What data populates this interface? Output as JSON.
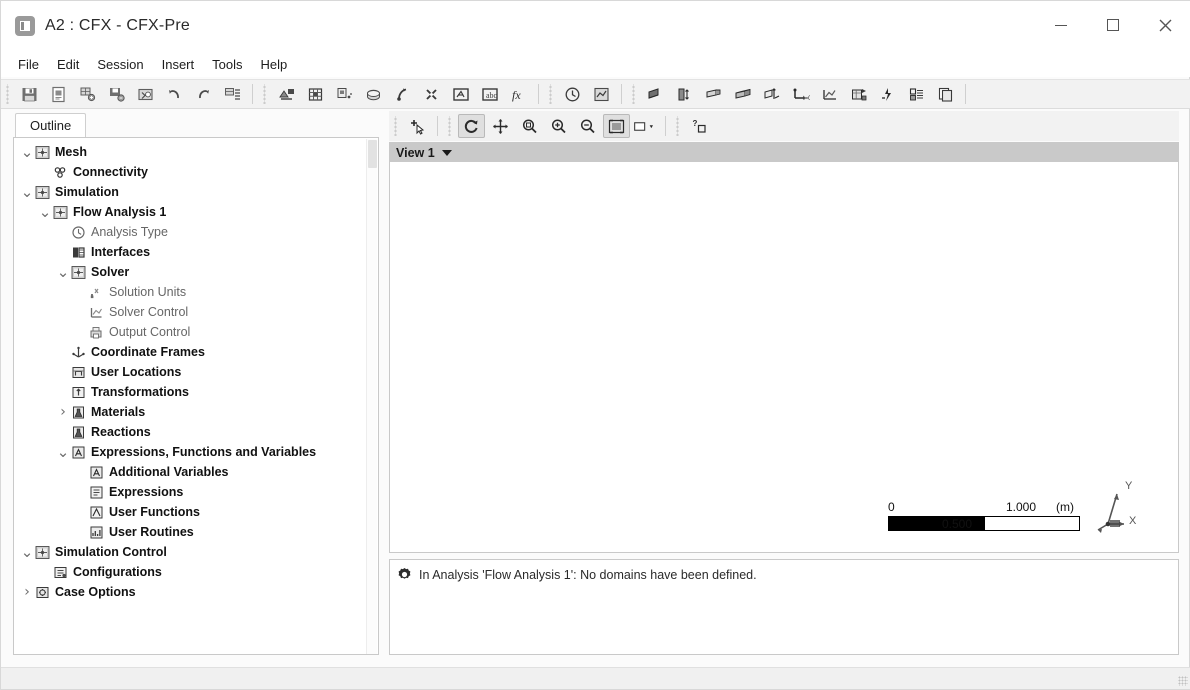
{
  "window": {
    "title": "A2 : CFX - CFX-Pre",
    "app_icon": "cfx-app-icon",
    "controls": {
      "minimize": "minimize-button",
      "maximize": "maximize-button",
      "close": "close-button"
    }
  },
  "menubar": {
    "items": [
      {
        "label": "File"
      },
      {
        "label": "Edit"
      },
      {
        "label": "Session"
      },
      {
        "label": "Insert"
      },
      {
        "label": "Tools"
      },
      {
        "label": "Help"
      }
    ]
  },
  "toolbar": {
    "groups": [
      {
        "buttons": [
          {
            "icon": "save-icon",
            "title": "Save Case"
          },
          {
            "icon": "save-as-icon",
            "title": "Save Case As"
          },
          {
            "icon": "import-mesh-icon",
            "title": "Import Mesh"
          },
          {
            "icon": "export-mesh-icon",
            "title": "Export Mesh"
          },
          {
            "icon": "refresh-mesh-icon",
            "title": "Reload Mesh Files"
          },
          {
            "icon": "undo-icon",
            "title": "Undo"
          },
          {
            "icon": "redo-icon",
            "title": "Redo"
          },
          {
            "icon": "define-run-icon",
            "title": "Define Run"
          }
        ]
      },
      {
        "buttons": [
          {
            "icon": "domain-icon",
            "title": "Insert Domain"
          },
          {
            "icon": "boundary-icon",
            "title": "Insert Boundary"
          },
          {
            "icon": "subdomain-icon",
            "title": "Insert Subdomain"
          },
          {
            "icon": "source-point-icon",
            "title": "Insert Source Point"
          },
          {
            "icon": "domain-interface-icon",
            "title": "Insert Domain Interface"
          },
          {
            "icon": "initialization-icon",
            "title": "Global Initialization"
          },
          {
            "icon": "expression-icon",
            "title": "Insert Expression"
          },
          {
            "icon": "user-function-icon",
            "title": "Insert User Function"
          }
        ]
      },
      {
        "buttons": [
          {
            "icon": "analysis-type-icon",
            "title": "Analysis Type"
          },
          {
            "icon": "solver-control-icon",
            "title": "Solver Control"
          }
        ]
      },
      {
        "buttons": [
          {
            "icon": "point-icon",
            "title": "Insert Point"
          },
          {
            "icon": "line-icon",
            "title": "Insert Line"
          },
          {
            "icon": "plane-icon",
            "title": "Insert Plane"
          },
          {
            "icon": "volume-icon",
            "title": "Insert Volume"
          },
          {
            "icon": "transform-icon",
            "title": "Insert Transformation"
          },
          {
            "icon": "iso-surface-icon",
            "title": "Insert Coordinate Frame"
          },
          {
            "icon": "chart-icon",
            "title": "Insert Chart"
          },
          {
            "icon": "material-icon",
            "title": "Insert Material"
          },
          {
            "icon": "reaction-icon",
            "title": "Insert Reaction"
          },
          {
            "icon": "additional-var-icon",
            "title": "Insert Additional Variable"
          },
          {
            "icon": "copy-icon",
            "title": "Duplicate"
          }
        ]
      }
    ]
  },
  "sidebar": {
    "tab": {
      "label": "Outline"
    },
    "tree": [
      {
        "label": "Mesh",
        "icon": "mesh-icon",
        "indent": 0,
        "chevron": "expanded",
        "style": "bold"
      },
      {
        "label": "Connectivity",
        "icon": "connectivity-icon",
        "indent": 1,
        "chevron": "none",
        "style": "bold"
      },
      {
        "label": "Simulation",
        "icon": "simulation-icon",
        "indent": 0,
        "chevron": "expanded",
        "style": "bold"
      },
      {
        "label": "Flow Analysis 1",
        "icon": "flow-analysis-icon",
        "indent": 1,
        "chevron": "expanded",
        "style": "bold"
      },
      {
        "label": "Analysis Type",
        "icon": "clock-icon",
        "indent": 2,
        "chevron": "none",
        "style": "dim"
      },
      {
        "label": "Interfaces",
        "icon": "interfaces-icon",
        "indent": 2,
        "chevron": "none",
        "style": "bold"
      },
      {
        "label": "Solver",
        "icon": "solver-icon",
        "indent": 2,
        "chevron": "expanded",
        "style": "bold"
      },
      {
        "label": "Solution Units",
        "icon": "solution-units-icon",
        "indent": 3,
        "chevron": "none",
        "style": "dim"
      },
      {
        "label": "Solver Control",
        "icon": "solver-control-tree-icon",
        "indent": 3,
        "chevron": "none",
        "style": "dim"
      },
      {
        "label": "Output Control",
        "icon": "output-control-icon",
        "indent": 3,
        "chevron": "none",
        "style": "dim"
      },
      {
        "label": "Coordinate Frames",
        "icon": "coordinate-frames-icon",
        "indent": 2,
        "chevron": "none",
        "style": "bold"
      },
      {
        "label": "User Locations",
        "icon": "user-locations-icon",
        "indent": 2,
        "chevron": "none",
        "style": "bold"
      },
      {
        "label": "Transformations",
        "icon": "transformations-icon",
        "indent": 2,
        "chevron": "none",
        "style": "bold"
      },
      {
        "label": "Materials",
        "icon": "materials-icon",
        "indent": 2,
        "chevron": "collapsed",
        "style": "bold"
      },
      {
        "label": "Reactions",
        "icon": "reactions-icon",
        "indent": 2,
        "chevron": "none",
        "style": "bold"
      },
      {
        "label": "Expressions, Functions and Variables",
        "icon": "expressions-group-icon",
        "indent": 2,
        "chevron": "expanded",
        "style": "bold"
      },
      {
        "label": "Additional Variables",
        "icon": "additional-variables-icon",
        "indent": 3,
        "chevron": "none",
        "style": "bold"
      },
      {
        "label": "Expressions",
        "icon": "expressions-icon",
        "indent": 3,
        "chevron": "none",
        "style": "bold"
      },
      {
        "label": "User Functions",
        "icon": "user-functions-icon",
        "indent": 3,
        "chevron": "none",
        "style": "bold"
      },
      {
        "label": "User Routines",
        "icon": "user-routines-icon",
        "indent": 3,
        "chevron": "none",
        "style": "bold"
      },
      {
        "label": "Simulation Control",
        "icon": "simulation-control-icon",
        "indent": 0,
        "chevron": "expanded",
        "style": "bold"
      },
      {
        "label": "Configurations",
        "icon": "configurations-icon",
        "indent": 1,
        "chevron": "none",
        "style": "bold"
      },
      {
        "label": "Case Options",
        "icon": "case-options-icon",
        "indent": 0,
        "chevron": "collapsed",
        "style": "bold"
      }
    ]
  },
  "viewer": {
    "toolbar": [
      {
        "icon": "select-cursor-icon",
        "pressed": false
      },
      {
        "icon": "rotate-icon",
        "pressed": true
      },
      {
        "icon": "pan-icon",
        "pressed": false
      },
      {
        "icon": "zoom-box-icon",
        "pressed": false
      },
      {
        "icon": "zoom-in-icon",
        "pressed": false
      },
      {
        "icon": "zoom-out-icon",
        "pressed": false
      },
      {
        "icon": "fit-view-icon",
        "pressed": true
      },
      {
        "icon": "background-color-icon",
        "pressed": false
      },
      {
        "icon": "snapshot-icon",
        "pressed": false
      }
    ],
    "view_label": "View 1",
    "scale_bar": {
      "min": "0",
      "mid": "0.500",
      "max": "1.000",
      "unit": "(m)"
    },
    "axes": {
      "y": "Y",
      "x": "X"
    }
  },
  "messages": {
    "icon": "error-gear-icon",
    "text": "In Analysis 'Flow Analysis 1': No domains have been defined."
  }
}
